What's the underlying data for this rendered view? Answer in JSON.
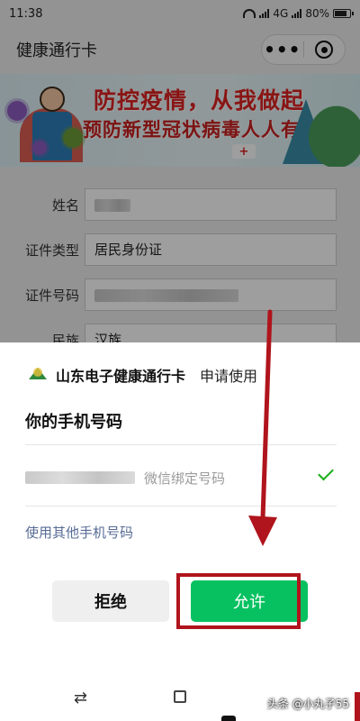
{
  "status_bar": {
    "time": "11:38",
    "network": "4G",
    "battery": "80%"
  },
  "nav_bar": {
    "title": "健康通行卡",
    "more_icon": "•••"
  },
  "banner": {
    "line1": "防控疫情，从我做起",
    "line2": "预防新型冠状病毒人人有责",
    "badge": "+"
  },
  "form": {
    "fields": [
      {
        "label": "姓名",
        "value": ""
      },
      {
        "label": "证件类型",
        "value": "居民身份证"
      },
      {
        "label": "证件号码",
        "value": ""
      },
      {
        "label": "民族",
        "value": "汉族"
      }
    ]
  },
  "auth_sheet": {
    "app_name": "山东电子健康通行卡",
    "request_text": "申请使用",
    "title": "你的手机号码",
    "phone_hint": "微信绑定号码",
    "other_link": "使用其他手机号码",
    "deny_label": "拒绝",
    "allow_label": "允许"
  },
  "system_nav": {
    "back_glyph": "⇄"
  },
  "watermark": "头条 @小丸子55",
  "colors": {
    "primary_green": "#07c160",
    "link_blue": "#576b95",
    "annotation_red": "#b0141c",
    "check_green": "#19ad19"
  },
  "icons": [
    "wifi-icon",
    "signal-icon",
    "battery-icon",
    "more-icon",
    "close-mini-program-icon",
    "check-icon",
    "app-logo-icon"
  ]
}
